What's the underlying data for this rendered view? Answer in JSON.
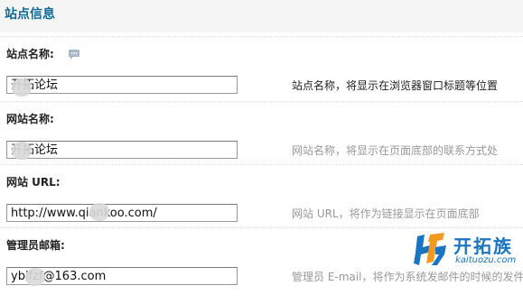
{
  "header": {
    "title": "站点信息"
  },
  "fields": [
    {
      "label": "站点名称:",
      "value": "开拓论坛",
      "hint": "站点名称，将显示在浏览器窗口标题等位置",
      "has_help_icon": true
    },
    {
      "label": "网站名称:",
      "value": "开拓论坛",
      "hint": "网站名称，将显示在页面底部的联系方式处"
    },
    {
      "label": "网站 URL:",
      "value": "http://www.qiankoo.com/",
      "hint": "网站 URL，将作为链接显示在页面底部"
    },
    {
      "label": "管理员邮箱:",
      "value": "yblfzf@163.com",
      "hint": "管理员 E-mail，将作为系统发邮件的时候的发件"
    }
  ],
  "watermark": {
    "name": "开拓族",
    "domain": "kaituozu.com"
  },
  "colors": {
    "title": "#0f6a97",
    "hint": "#999999",
    "logo": "#1a74c2"
  }
}
